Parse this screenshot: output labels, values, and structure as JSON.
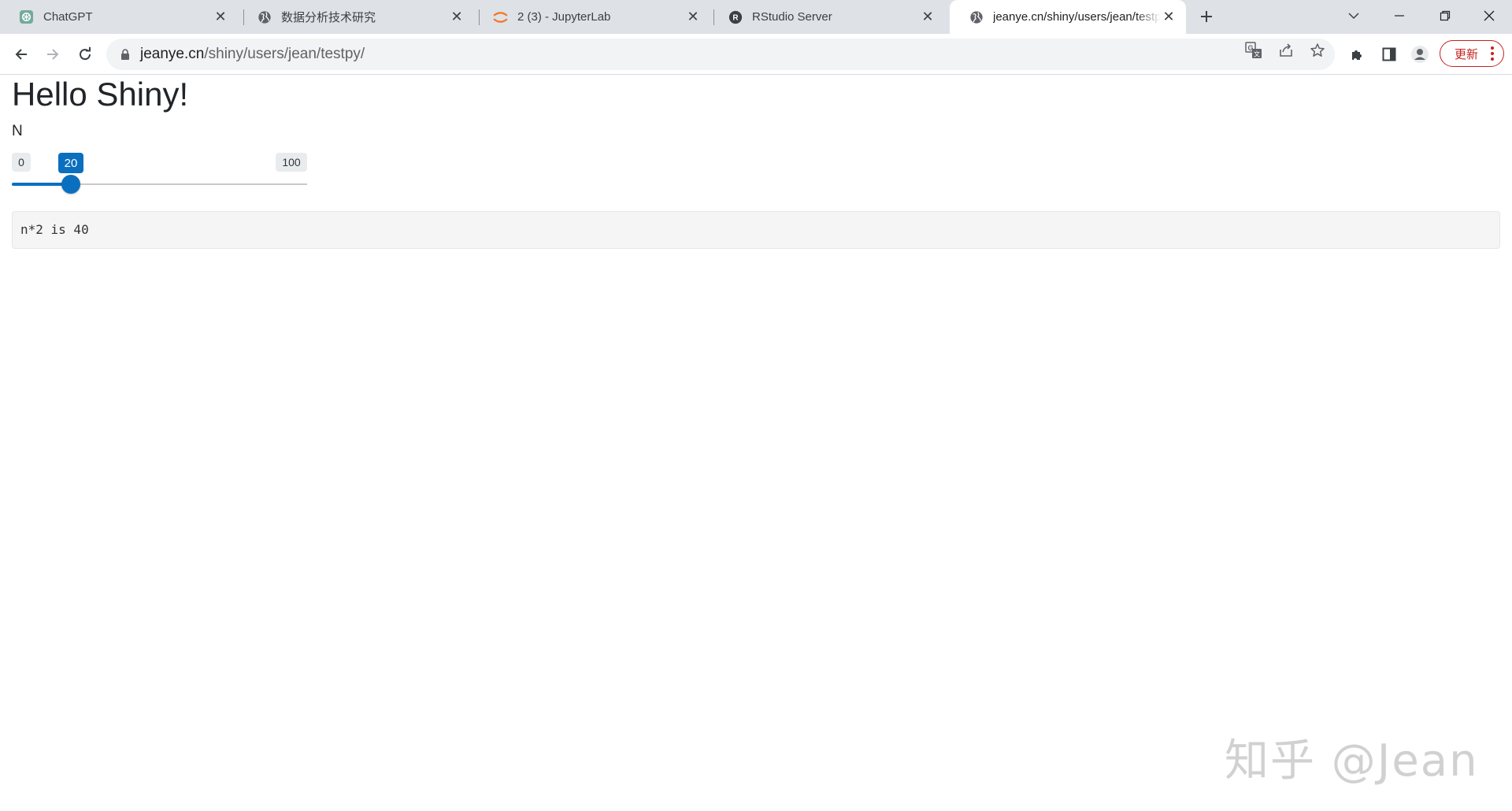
{
  "tabs": [
    {
      "title": "ChatGPT",
      "icon": "chatgpt-icon",
      "active": false
    },
    {
      "title": "数据分析技术研究",
      "icon": "globe-icon",
      "active": false
    },
    {
      "title": "2 (3) - JupyterLab",
      "icon": "jupyter-icon",
      "active": false
    },
    {
      "title": "RStudio Server",
      "icon": "rstudio-icon",
      "active": false
    },
    {
      "title": "jeanye.cn/shiny/users/jean/testpy/",
      "icon": "globe-icon",
      "active": true
    }
  ],
  "address_bar": {
    "host": "jeanye.cn",
    "path": "/shiny/users/jean/testpy/"
  },
  "toolbar": {
    "update_label": "更新"
  },
  "app": {
    "title": "Hello Shiny!",
    "slider": {
      "label": "N",
      "min": 0,
      "max": 100,
      "value": 20
    },
    "output_text": "n*2 is 40"
  },
  "watermark": "知乎 @Jean",
  "colors": {
    "accent": "#0b6fbf",
    "update_red": "#c5221f"
  }
}
